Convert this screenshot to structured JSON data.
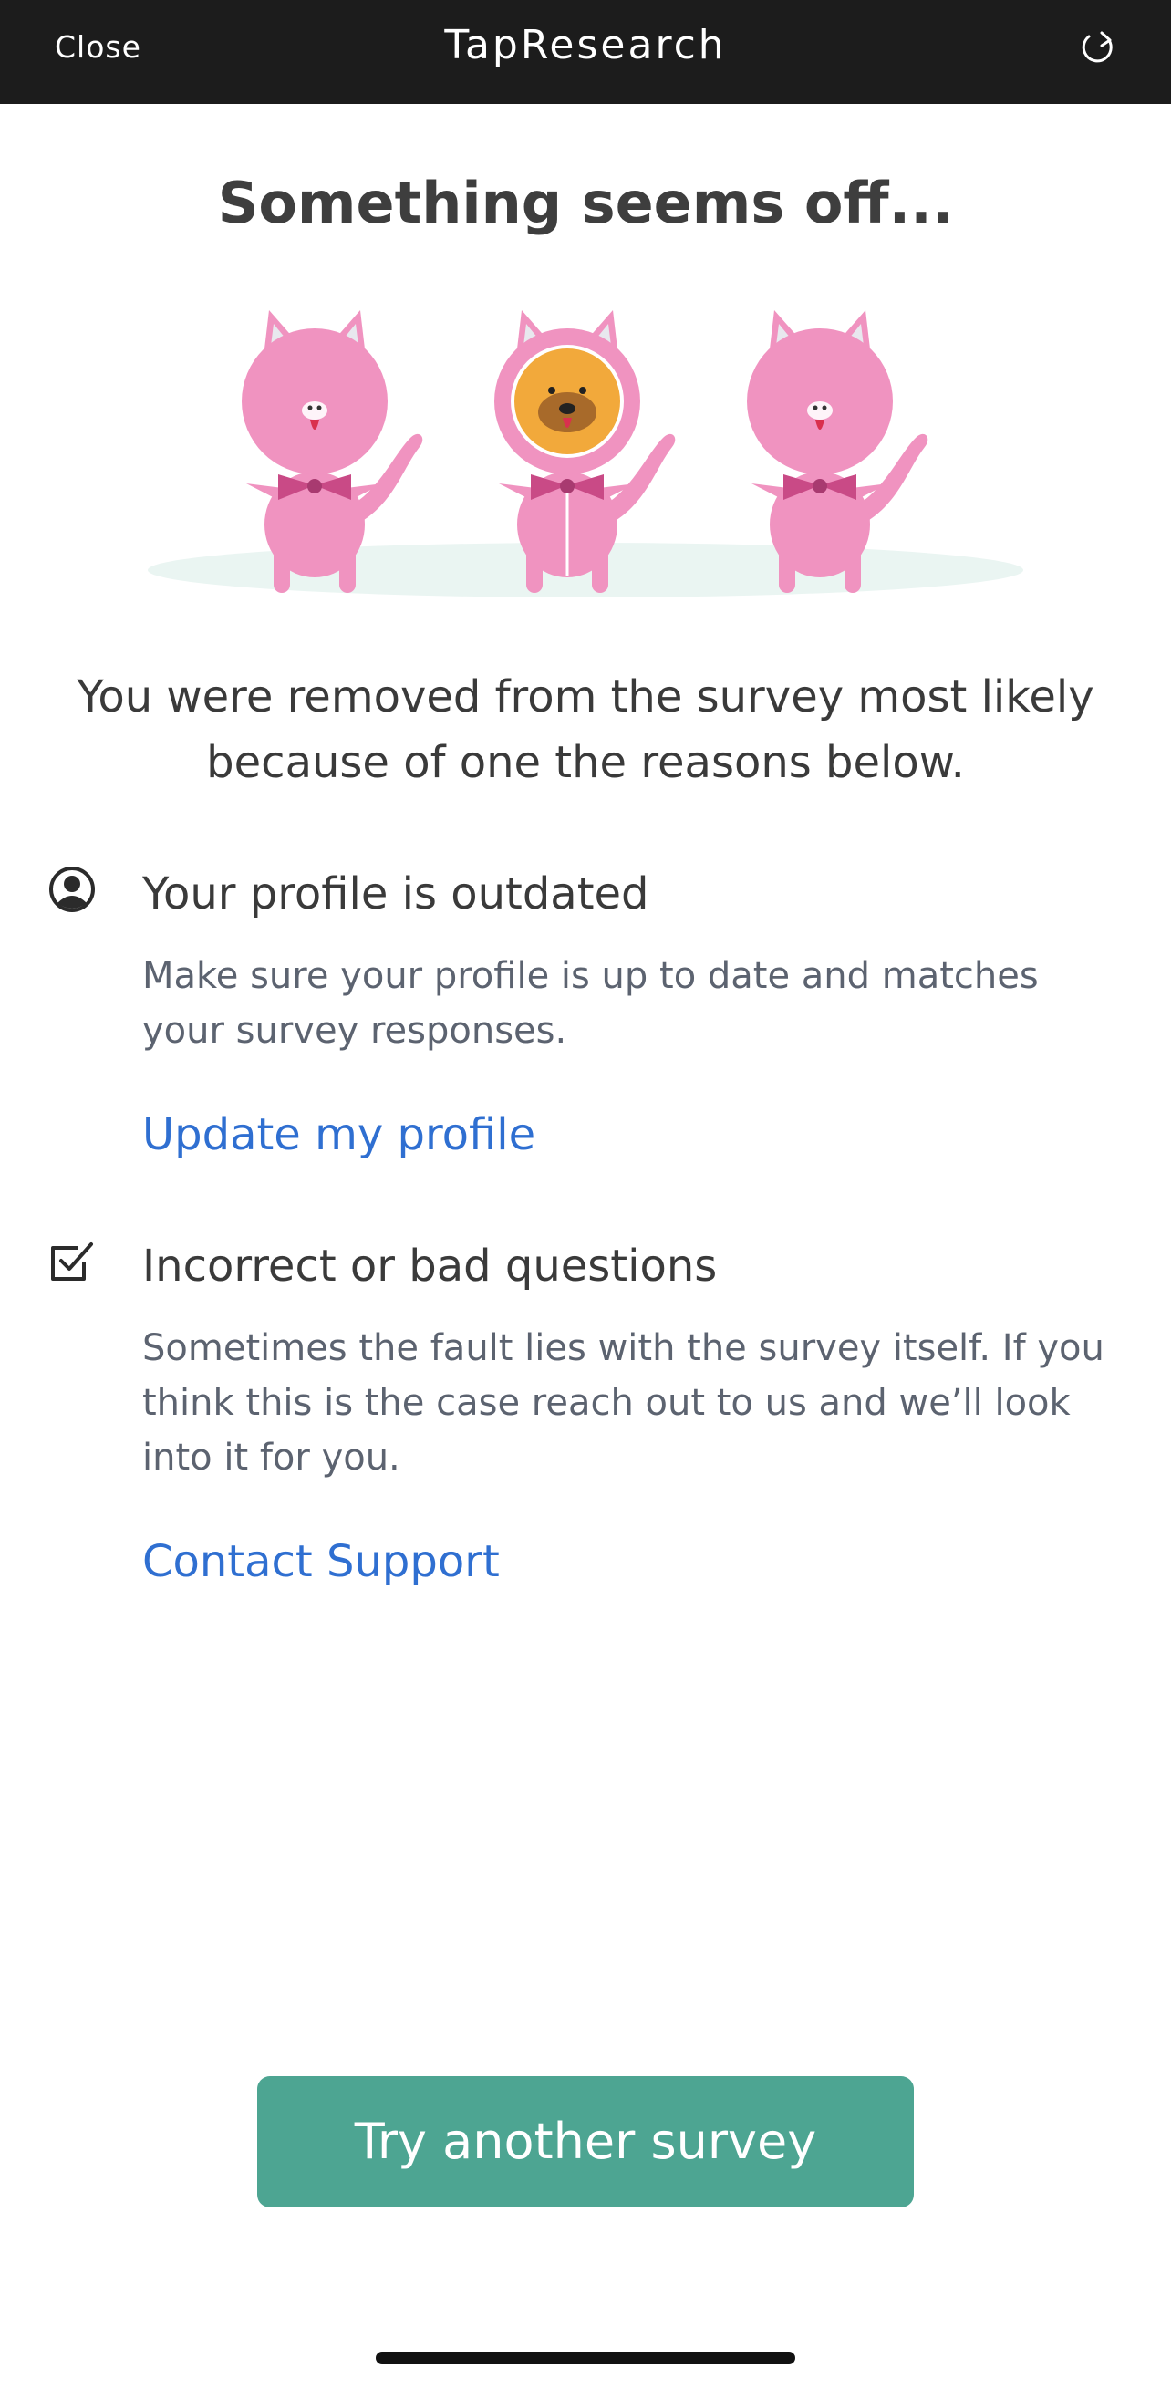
{
  "topbar": {
    "close_label": "Close",
    "title": "TapResearch",
    "refresh_icon": "refresh-icon"
  },
  "main": {
    "heading": "Something seems off...",
    "intro": "You were removed from the survey most likely because of one the reasons below.",
    "reasons": [
      {
        "icon": "user-circle-icon",
        "title": "Your profile is outdated",
        "description": "Make sure your profile is up to date and matches your survey responses.",
        "link": "Update my profile"
      },
      {
        "icon": "checkbox-icon",
        "title": "Incorrect or bad questions",
        "description": "Sometimes the fault lies with the survey itself. If you think this is the case reach out to us and we’ll look into it for you.",
        "link": "Contact Support"
      }
    ],
    "cta_label": "Try another survey"
  },
  "colors": {
    "topbar_bg": "#1c1c1c",
    "accent_link": "#2f6fd1",
    "cta_bg": "#4da592",
    "cat_pink": "#f093c0",
    "bowtie": "#c94a86",
    "dog_orange": "#f2a93b"
  }
}
